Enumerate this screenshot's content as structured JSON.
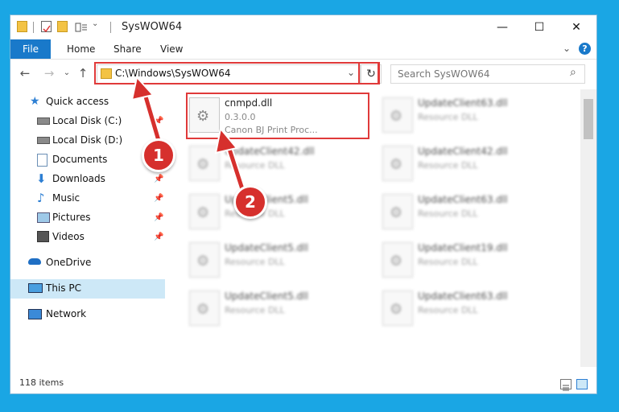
{
  "window": {
    "title": "SysWOW64",
    "controls": {
      "minimize": "—",
      "maximize": "☐",
      "close": "✕"
    }
  },
  "ribbon": {
    "tabs": [
      "File",
      "Home",
      "Share",
      "View"
    ],
    "expand_icon": "⌄",
    "help_icon": "?"
  },
  "navigation": {
    "back": "←",
    "forward": "→",
    "recent": "⌄",
    "up": "↑",
    "address": "C:\\Windows\\SysWOW64",
    "address_dropdown": "⌄",
    "refresh": "↻",
    "search_placeholder": "Search SysWOW64",
    "search_icon": "⌕"
  },
  "sidebar": {
    "items": [
      {
        "label": "Quick access",
        "icon": "star-icon",
        "pinned": false
      },
      {
        "label": "Local Disk (C:)",
        "icon": "drive-icon",
        "pinned": true
      },
      {
        "label": "Local Disk (D:)",
        "icon": "drive-icon",
        "pinned": false
      },
      {
        "label": "Documents",
        "icon": "document-icon",
        "pinned": true
      },
      {
        "label": "Downloads",
        "icon": "download-icon",
        "pinned": true
      },
      {
        "label": "Music",
        "icon": "music-icon",
        "pinned": true
      },
      {
        "label": "Pictures",
        "icon": "pictures-icon",
        "pinned": true
      },
      {
        "label": "Videos",
        "icon": "video-icon",
        "pinned": true
      },
      {
        "label": "OneDrive",
        "icon": "cloud-icon",
        "pinned": false
      },
      {
        "label": "This PC",
        "icon": "computer-icon",
        "pinned": false,
        "selected": true
      },
      {
        "label": "Network",
        "icon": "network-icon",
        "pinned": false
      }
    ],
    "pin_glyph": "📌"
  },
  "files": [
    {
      "name": "cnmpd.dll",
      "version": "0.3.0.0",
      "desc": "Canon BJ Print Proc...",
      "selected": true
    },
    {
      "name": "UpdateClient63.dll",
      "desc": "Resource DLL"
    },
    {
      "name": "UpdateClient42.dll",
      "desc": "Resource DLL"
    },
    {
      "name": "UpdateClient42.dll",
      "desc": "Resource DLL"
    },
    {
      "name": "UpdateClient5.dll",
      "desc": "Resource DLL"
    },
    {
      "name": "UpdateClient63.dll",
      "desc": "Resource DLL"
    },
    {
      "name": "UpdateClient5.dll",
      "desc": "Resource DLL"
    },
    {
      "name": "UpdateClient19.dll",
      "desc": "Resource DLL"
    },
    {
      "name": "UpdateClient5.dll",
      "desc": "Resource DLL"
    },
    {
      "name": "UpdateClient63.dll",
      "desc": "Resource DLL"
    }
  ],
  "status": {
    "item_count": "118 items"
  },
  "callouts": {
    "one": "1",
    "two": "2"
  },
  "colors": {
    "accent": "#1979ca",
    "highlight": "#e03a3a",
    "desktop": "#1aa6e4",
    "selected_nav": "#cde8f7"
  }
}
